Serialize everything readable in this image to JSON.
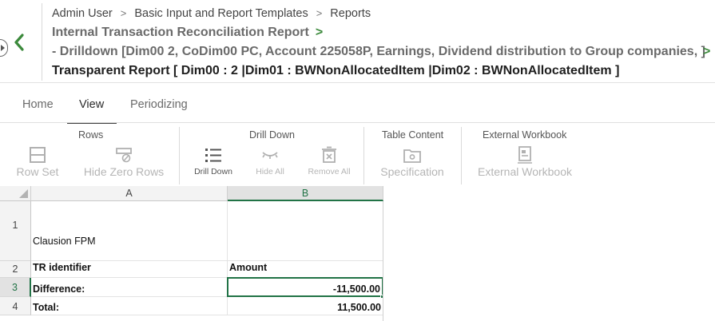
{
  "breadcrumb": {
    "items": [
      "Admin User",
      "Basic Input and Report Templates",
      "Reports"
    ],
    "separator": ">"
  },
  "title": {
    "line1": "Internal Transaction Reconciliation Report",
    "line2": "- Drilldown [Dim00 2, CoDim00 PC, Account 225058P, Earnings, Dividend distribution to Group companies, ]",
    "line3": "Transparent Report [ Dim00 : 2 |Dim01 : BWNonAllocatedItem |Dim02 : BWNonAllocatedItem ]",
    "chevron": ">"
  },
  "tabs": [
    {
      "label": "Home"
    },
    {
      "label": "View"
    },
    {
      "label": "Periodizing"
    }
  ],
  "active_tab": "View",
  "ribbon": {
    "groups": {
      "rows": "Rows",
      "drill_down": "Drill Down",
      "table_content": "Table Content",
      "external_workbook": "External Workbook"
    },
    "buttons": {
      "row_set": "Row Set",
      "hide_zero_rows": "Hide Zero Rows",
      "drill_down": "Drill Down",
      "hide_all": "Hide All",
      "remove_all": "Remove All",
      "specification": "Specification",
      "external_workbook": "External Workbook"
    }
  },
  "grid": {
    "columns": [
      "A",
      "B"
    ],
    "rows": [
      "1",
      "2",
      "3",
      "4"
    ],
    "cells": {
      "a1": "Clausion FPM",
      "a2": "TR identifier",
      "b2": "Amount",
      "a3": "Difference:",
      "b3": "-11,500.00",
      "a4": "Total:",
      "b4": "11,500.00"
    },
    "selected_cell": "B3"
  },
  "colors": {
    "accent_green": "#217346",
    "chevron_green": "#3c8a3c",
    "disabled_text": "#b5b5b5"
  }
}
